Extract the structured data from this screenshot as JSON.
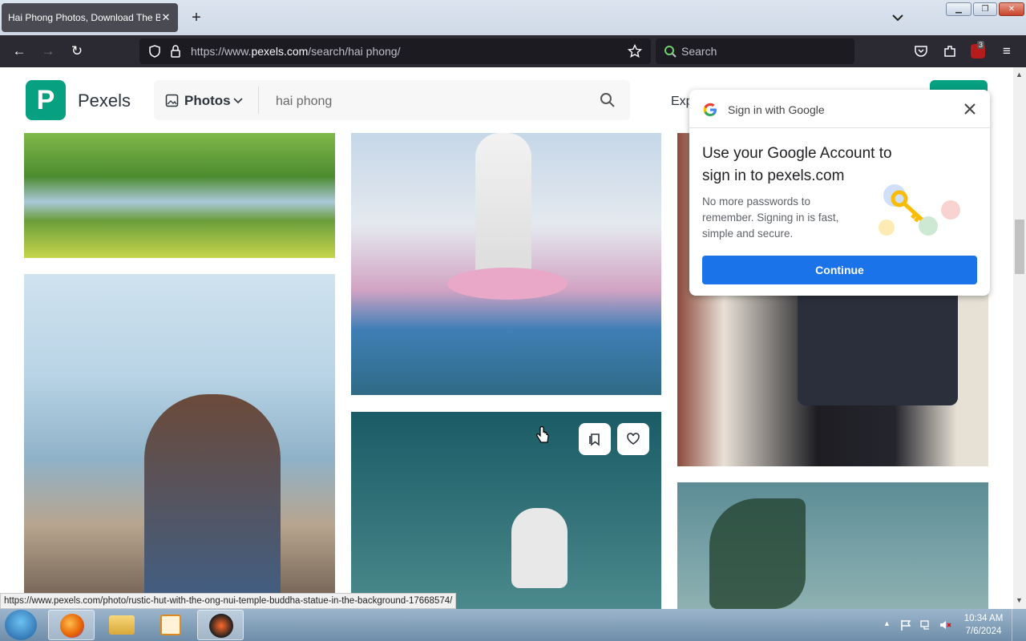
{
  "browser": {
    "tab_title": "Hai Phong Photos, Download The B",
    "new_tab": "+",
    "url_prefix": "https://www.",
    "url_domain": "pexels.com",
    "url_path": "/search/hai phong/",
    "search_placeholder": "Search",
    "extension_badge": "3"
  },
  "header": {
    "logo_letter": "P",
    "brand": "Pexels",
    "type_label": "Photos",
    "search_value": "hai phong",
    "explore_label": "Exp"
  },
  "google_popup": {
    "title": "Sign in with Google",
    "heading": "Use your Google Account to sign in to pexels.com",
    "body": "No more passwords to remember. Signing in is fast, simple and secure.",
    "continue_label": "Continue"
  },
  "status_url": "https://www.pexels.com/photo/rustic-hut-with-the-ong-nui-temple-buddha-statue-in-the-background-17668574/",
  "taskbar": {
    "time": "10:34 AM",
    "date": "7/6/2024"
  },
  "colors": {
    "pexels_green": "#07a081",
    "google_blue": "#1a73e8"
  }
}
